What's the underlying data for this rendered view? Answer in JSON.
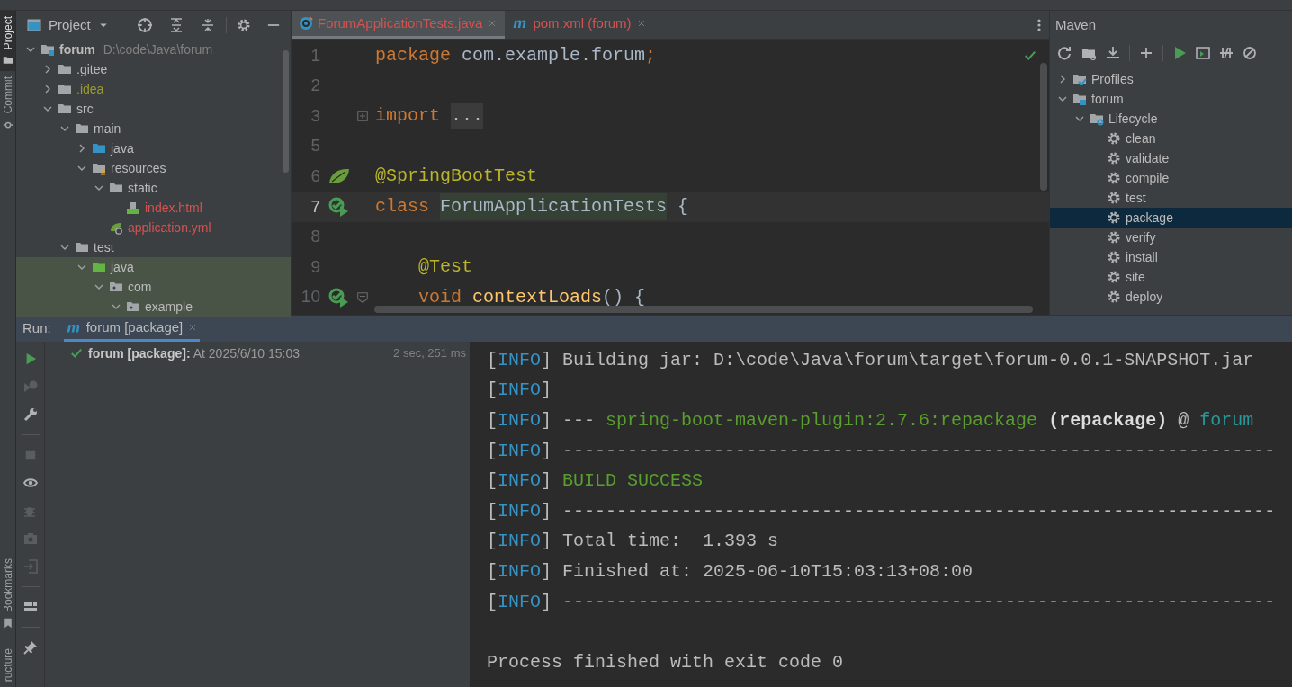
{
  "side_tabs_top": [
    {
      "label": "Project",
      "kind": "project",
      "selected": true
    },
    {
      "label": "Commit",
      "kind": "commit",
      "selected": false
    }
  ],
  "side_tabs_bottom": [
    {
      "label": "Bookmarks",
      "kind": "bookmarks",
      "selected": false
    },
    {
      "label": "ructure",
      "kind": "structure",
      "selected": false
    }
  ],
  "project_panel": {
    "title": "Project",
    "tree": [
      {
        "label": "forum",
        "path": "D:\\code\\Java\\forum",
        "kind": "module",
        "expanded": true,
        "children": [
          {
            "label": ".gitee",
            "kind": "folder",
            "expanded": false
          },
          {
            "label": ".idea",
            "kind": "folder",
            "expanded": false,
            "color": "#9b9b2d"
          },
          {
            "label": "src",
            "kind": "folder",
            "expanded": true,
            "children": [
              {
                "label": "main",
                "kind": "folder",
                "expanded": true,
                "children": [
                  {
                    "label": "java",
                    "kind": "source",
                    "expanded": false
                  },
                  {
                    "label": "resources",
                    "kind": "resources",
                    "expanded": true,
                    "children": [
                      {
                        "label": "static",
                        "kind": "folder",
                        "expanded": true,
                        "children": [
                          {
                            "label": "index.html",
                            "kind": "html",
                            "color": "#d25252"
                          }
                        ]
                      },
                      {
                        "label": "application.yml",
                        "kind": "yml",
                        "color": "#d25252"
                      }
                    ]
                  }
                ]
              },
              {
                "label": "test",
                "kind": "folder",
                "expanded": true,
                "children": [
                  {
                    "label": "java",
                    "kind": "test",
                    "expanded": true,
                    "highlighted": true,
                    "children": [
                      {
                        "label": "com",
                        "kind": "package",
                        "expanded": true,
                        "highlighted": true,
                        "children": [
                          {
                            "label": "example",
                            "kind": "package",
                            "expanded": true,
                            "highlighted": true
                          }
                        ]
                      }
                    ]
                  }
                ]
              }
            ]
          }
        ]
      }
    ]
  },
  "editor": {
    "tabs": [
      {
        "label": "ForumApplicationTests.java",
        "kind": "class",
        "selected": true,
        "color": "#d25252"
      },
      {
        "label": "pom.xml (forum)",
        "kind": "maven",
        "selected": false,
        "color": "#d25252"
      }
    ],
    "lines": [
      {
        "number": "1",
        "tokens": [
          {
            "text": "package",
            "kind": "keyword"
          },
          {
            "text": " com.example.forum",
            "kind": "plain"
          },
          {
            "text": ";",
            "kind": "keyword"
          }
        ]
      },
      {
        "number": "2"
      },
      {
        "number": "3",
        "fold_marker": {
          "kind": "expand"
        },
        "tokens": [
          {
            "text": "import",
            "kind": "keyword"
          },
          {
            "text": "...",
            "kind": "folded"
          }
        ]
      },
      {
        "number": "5"
      },
      {
        "number": "6",
        "gutter_icon": {
          "kind": "spring"
        },
        "tokens": [
          {
            "text": "@SpringBootTest",
            "kind": "annotation"
          }
        ]
      },
      {
        "number": "7",
        "gutter_icon": {
          "kind": "run"
        },
        "current": true,
        "tokens": [
          {
            "text": "class",
            "kind": "keyword"
          },
          {
            "text": "ForumApplicationTests",
            "kind": "highlight"
          },
          {
            "text": " {",
            "kind": "plain"
          }
        ]
      },
      {
        "number": "8"
      },
      {
        "number": "9",
        "indented": true,
        "tokens": [
          {
            "text": "@Test",
            "kind": "annotation"
          }
        ]
      },
      {
        "number": "10",
        "indented": true,
        "gutter_icon": {
          "kind": "run"
        },
        "fold_marker": {
          "kind": "collapse"
        },
        "tokens": [
          {
            "text": "void",
            "kind": "keyword"
          },
          {
            "text": "contextLoads",
            "kind": "method"
          },
          {
            "text": "() {",
            "kind": "plain"
          }
        ]
      }
    ]
  },
  "maven_panel": {
    "title": "Maven",
    "tree": [
      {
        "label": "Profiles",
        "kind": "profiles",
        "expanded": false,
        "selected": false
      },
      {
        "label": "forum",
        "kind": "maven-module",
        "expanded": true,
        "selected": false,
        "children": [
          {
            "label": "Lifecycle",
            "kind": "lifecycle",
            "expanded": true,
            "selected": false,
            "children": [
              {
                "label": "clean",
                "kind": "goal",
                "selected": false
              },
              {
                "label": "validate",
                "kind": "goal",
                "selected": false
              },
              {
                "label": "compile",
                "kind": "goal",
                "selected": false
              },
              {
                "label": "test",
                "kind": "goal",
                "selected": false
              },
              {
                "label": "package",
                "kind": "goal",
                "selected": true
              },
              {
                "label": "verify",
                "kind": "goal",
                "selected": false
              },
              {
                "label": "install",
                "kind": "goal",
                "selected": false
              },
              {
                "label": "site",
                "kind": "goal",
                "selected": false
              },
              {
                "label": "deploy",
                "kind": "goal",
                "selected": false
              }
            ]
          }
        ]
      }
    ]
  },
  "run_panel": {
    "label": "Run:",
    "tabs": [
      {
        "label": "forum [package]",
        "selected": true
      }
    ],
    "toolbar": [
      {
        "kind": "play",
        "disabled": false
      },
      {
        "kind": "rerun",
        "disabled": true
      },
      {
        "kind": "wrench",
        "disabled": false
      },
      {
        "kind": "sep"
      },
      {
        "kind": "stop",
        "disabled": true
      },
      {
        "kind": "eye",
        "disabled": false
      },
      {
        "kind": "bug",
        "disabled": true
      },
      {
        "kind": "camera",
        "disabled": true
      },
      {
        "kind": "exit",
        "disabled": true
      },
      {
        "kind": "sep"
      },
      {
        "kind": "layout",
        "disabled": false
      },
      {
        "kind": "sep"
      },
      {
        "kind": "pin",
        "disabled": false
      }
    ],
    "result": {
      "text": "**forum [package]:** At 2025/6/10 15:03",
      "duration": "2 sec, 251 ms"
    },
    "console": [
      {
        "kind": "text",
        "tokens": [
          {
            "text": "[",
            "kind": "plain"
          },
          {
            "text": "INFO",
            "kind": "info"
          },
          {
            "text": "] Building jar: D:\\code\\Java\\forum\\target\\forum-0.0.1-SNAPSHOT.jar",
            "kind": "plain"
          }
        ]
      },
      {
        "kind": "text",
        "tokens": [
          {
            "text": "[",
            "kind": "plain"
          },
          {
            "text": "INFO",
            "kind": "info"
          },
          {
            "text": "]",
            "kind": "plain"
          }
        ]
      },
      {
        "kind": "text",
        "tokens": [
          {
            "text": "[",
            "kind": "plain"
          },
          {
            "text": "INFO",
            "kind": "info"
          },
          {
            "text": "] ---",
            "kind": "plain"
          },
          {
            "text": "spring-boot-maven-plugin:2.7.6:repackage",
            "kind": "green"
          },
          {
            "text": "(repackage)",
            "kind": "bold"
          },
          {
            "text": "@",
            "kind": "plain"
          },
          {
            "text": "forum",
            "kind": "teal"
          }
        ]
      },
      {
        "kind": "text",
        "tokens": [
          {
            "text": "[",
            "kind": "plain"
          },
          {
            "text": "INFO",
            "kind": "info"
          },
          {
            "text": "] ------------------------------------------------------------------",
            "kind": "plain"
          }
        ]
      },
      {
        "kind": "text",
        "tokens": [
          {
            "text": "[",
            "kind": "plain"
          },
          {
            "text": "INFO",
            "kind": "info"
          },
          {
            "text": "]",
            "kind": "plain"
          },
          {
            "text": "BUILD SUCCESS",
            "kind": "green"
          }
        ]
      },
      {
        "kind": "text",
        "tokens": [
          {
            "text": "[",
            "kind": "plain"
          },
          {
            "text": "INFO",
            "kind": "info"
          },
          {
            "text": "] ------------------------------------------------------------------",
            "kind": "plain"
          }
        ]
      },
      {
        "kind": "text",
        "tokens": [
          {
            "text": "[",
            "kind": "plain"
          },
          {
            "text": "INFO",
            "kind": "info"
          },
          {
            "text": "] Total time:  1.393 s",
            "kind": "plain"
          }
        ]
      },
      {
        "kind": "text",
        "tokens": [
          {
            "text": "[",
            "kind": "plain"
          },
          {
            "text": "INFO",
            "kind": "info"
          },
          {
            "text": "] Finished at: 2025-06-10T15:03:13+08:00",
            "kind": "plain"
          }
        ]
      },
      {
        "kind": "text",
        "tokens": [
          {
            "text": "[",
            "kind": "plain"
          },
          {
            "text": "INFO",
            "kind": "info"
          },
          {
            "text": "] ------------------------------------------------------------------",
            "kind": "plain"
          }
        ]
      },
      {
        "kind": "blank"
      },
      {
        "kind": "text",
        "tokens": [
          {
            "text": "Process finished with exit code 0",
            "kind": "plain"
          }
        ]
      }
    ]
  }
}
